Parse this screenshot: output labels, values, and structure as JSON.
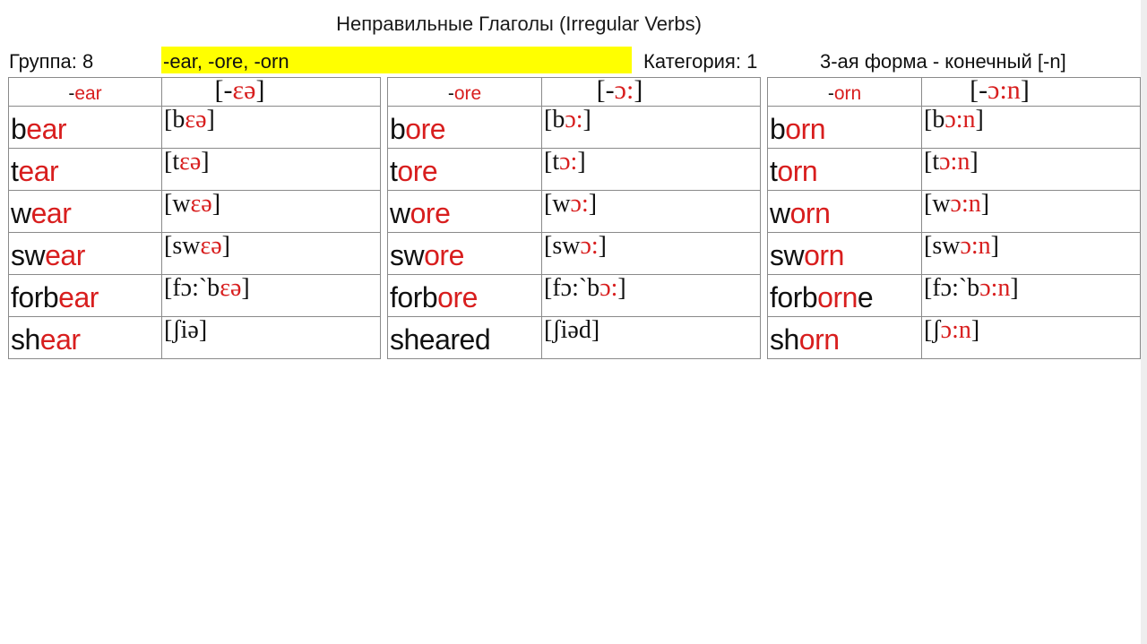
{
  "title": "Неправильные Глаголы (Irregular Verbs)",
  "info": {
    "group_label": "Группа: 8",
    "highlight_text": "-ear, -ore, -orn",
    "category_label": "Категория: 1",
    "form_note": "3-ая форма - конечный [-n]"
  },
  "colors": {
    "highlight": "#ffff00",
    "accent_red": "#d81e1e",
    "text": "#111111",
    "border": "#8a8a8a"
  },
  "tables": [
    {
      "id": "ear",
      "header": {
        "suffix_prefix": "-",
        "suffix": "ear",
        "ipa_open": "[-",
        "ipa": "εə",
        "ipa_close": "]"
      },
      "rows": [
        {
          "stem": "b",
          "ending": "ear",
          "tail": "",
          "ipa_open": "[b",
          "ipa_red": "εə",
          "ipa_tail": "",
          "ipa_close": "]"
        },
        {
          "stem": "t",
          "ending": "ear",
          "tail": "",
          "ipa_open": "[t",
          "ipa_red": "εə",
          "ipa_tail": "",
          "ipa_close": "]"
        },
        {
          "stem": "w",
          "ending": "ear",
          "tail": "",
          "ipa_open": "[w",
          "ipa_red": "εə",
          "ipa_tail": "",
          "ipa_close": "]"
        },
        {
          "stem": "sw",
          "ending": "ear",
          "tail": "",
          "ipa_open": "[sw",
          "ipa_red": "εə",
          "ipa_tail": "",
          "ipa_close": "]"
        },
        {
          "stem": "forb",
          "ending": "ear",
          "tail": "",
          "ipa_open": "[fɔ:`b",
          "ipa_red": "εə",
          "ipa_tail": "",
          "ipa_close": "]"
        },
        {
          "stem": "sh",
          "ending": "ear",
          "tail": "",
          "ipa_open": "[ʃiə",
          "ipa_red": "",
          "ipa_tail": "",
          "ipa_close": "]"
        }
      ]
    },
    {
      "id": "ore",
      "header": {
        "suffix_prefix": "-",
        "suffix": "ore",
        "ipa_open": "[-",
        "ipa": "ɔ:",
        "ipa_close": "]"
      },
      "rows": [
        {
          "stem": "b",
          "ending": "ore",
          "tail": "",
          "ipa_open": "[b",
          "ipa_red": "ɔ:",
          "ipa_tail": "",
          "ipa_close": "]"
        },
        {
          "stem": "t",
          "ending": "ore",
          "tail": "",
          "ipa_open": "[t",
          "ipa_red": "ɔ:",
          "ipa_tail": "",
          "ipa_close": "]"
        },
        {
          "stem": "w",
          "ending": "ore",
          "tail": "",
          "ipa_open": "[w",
          "ipa_red": "ɔ:",
          "ipa_tail": "",
          "ipa_close": "]"
        },
        {
          "stem": "sw",
          "ending": "ore",
          "tail": "",
          "ipa_open": "[sw",
          "ipa_red": "ɔ:",
          "ipa_tail": "",
          "ipa_close": "]"
        },
        {
          "stem": "forb",
          "ending": "ore",
          "tail": "",
          "ipa_open": "[fɔ:`b",
          "ipa_red": "ɔ:",
          "ipa_tail": "",
          "ipa_close": "]"
        },
        {
          "stem": "sheared",
          "ending": "",
          "tail": "",
          "ipa_open": "[ʃiəd",
          "ipa_red": "",
          "ipa_tail": "",
          "ipa_close": "]"
        }
      ]
    },
    {
      "id": "orn",
      "header": {
        "suffix_prefix": "-",
        "suffix": "orn",
        "ipa_open": "[-",
        "ipa": "ɔ:n",
        "ipa_close": "]"
      },
      "rows": [
        {
          "stem": "b",
          "ending": "orn",
          "tail": "",
          "ipa_open": "[b",
          "ipa_red": "ɔ:n",
          "ipa_tail": "",
          "ipa_close": "]"
        },
        {
          "stem": "t",
          "ending": "orn",
          "tail": "",
          "ipa_open": "[t",
          "ipa_red": "ɔ:n",
          "ipa_tail": "",
          "ipa_close": "]"
        },
        {
          "stem": "w",
          "ending": "orn",
          "tail": "",
          "ipa_open": "[w",
          "ipa_red": "ɔ:n",
          "ipa_tail": "",
          "ipa_close": "]"
        },
        {
          "stem": "sw",
          "ending": "orn",
          "tail": "",
          "ipa_open": "[sw",
          "ipa_red": "ɔ:n",
          "ipa_tail": "",
          "ipa_close": "]"
        },
        {
          "stem": "forb",
          "ending": "orn",
          "tail": "e",
          "ipa_open": "[fɔ:`b",
          "ipa_red": "ɔ:n",
          "ipa_tail": "",
          "ipa_close": "]"
        },
        {
          "stem": "sh",
          "ending": "orn",
          "tail": "",
          "ipa_open": "[ʃ",
          "ipa_red": "ɔ:n",
          "ipa_tail": "",
          "ipa_close": "]"
        }
      ]
    }
  ]
}
